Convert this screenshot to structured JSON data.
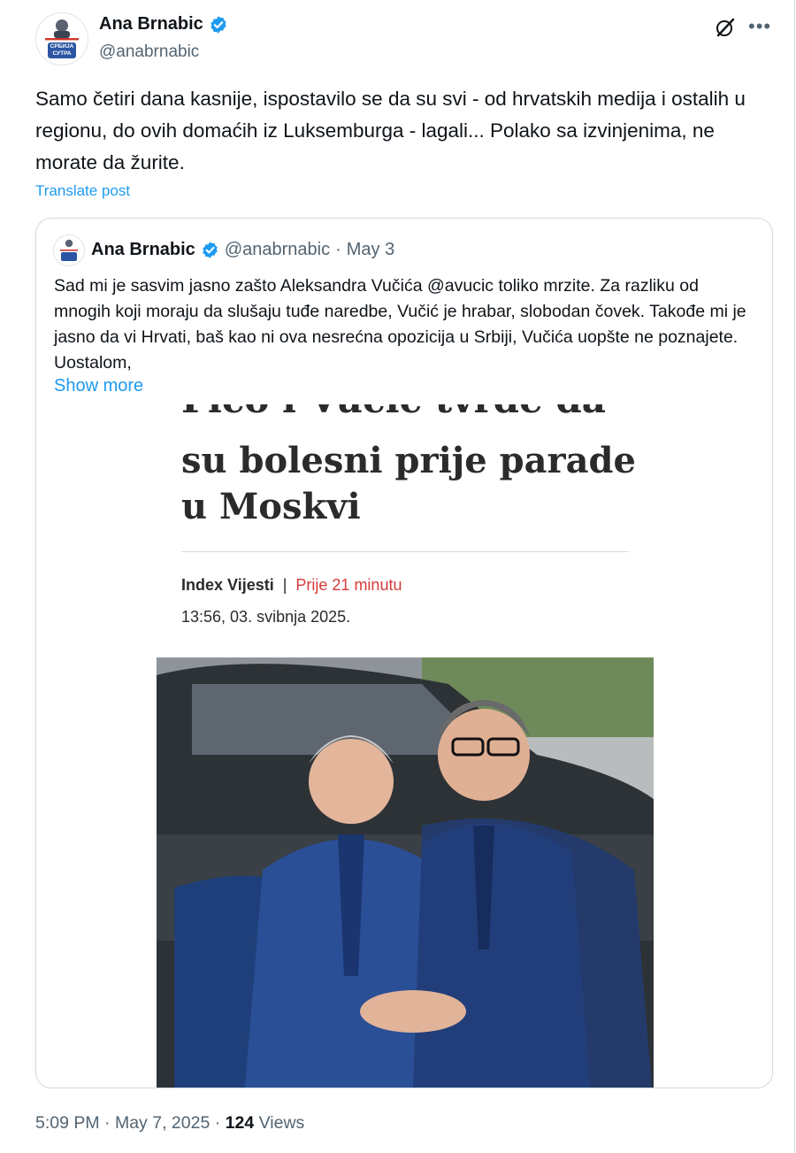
{
  "tweet": {
    "author_name": "Ana Brnabic",
    "author_handle": "@anabrnabic",
    "avatar_badge_lines": [
      "СРБИЈА",
      "СУТРА"
    ],
    "text": "Samo četiri dana kasnije, ispostavilo se da su svi - od hrvatskih medija i ostalih u regionu, do ovih domaćih iz Luksemburga - lagali... Polako sa izvinjenima, ne morate da žurite.",
    "translate_label": "Translate post",
    "time": "5:09 PM",
    "date": "May 7, 2025",
    "views_count": "124",
    "views_label": "Views"
  },
  "quote": {
    "author_name": "Ana Brnabic",
    "author_handle": "@anabrnabic",
    "date": "May 3",
    "text": "Sad mi je sasvim jasno zašto Aleksandra Vučića @avucic toliko mrzite. Za razliku od mnogih koji moraju da slušaju tuđe naredbe, Vučić je hrabar, slobodan čovek. Takođe mi je jasno da vi Hrvati, baš kao ni ova nesrećna opozicija u Srbiji, Vučića uopšte ne poznajete. Uostalom,",
    "show_more_label": "Show more"
  },
  "article": {
    "headline_cut": "Fico i Vučić tvrde da",
    "headline_line1": "su bolesni prije parade",
    "headline_line2": "u Moskvi",
    "source": "Index Vijesti",
    "separator": "|",
    "ago": "Prije 21 minutu",
    "datetime": "13:56, 03. svibnja 2025."
  },
  "icons": {
    "verified": "verified-badge-icon",
    "grok": "grok-icon",
    "more": "more-icon"
  },
  "colors": {
    "accent": "#1d9bf0",
    "secondary_text": "#536471",
    "ago_red": "#d73a3a"
  }
}
